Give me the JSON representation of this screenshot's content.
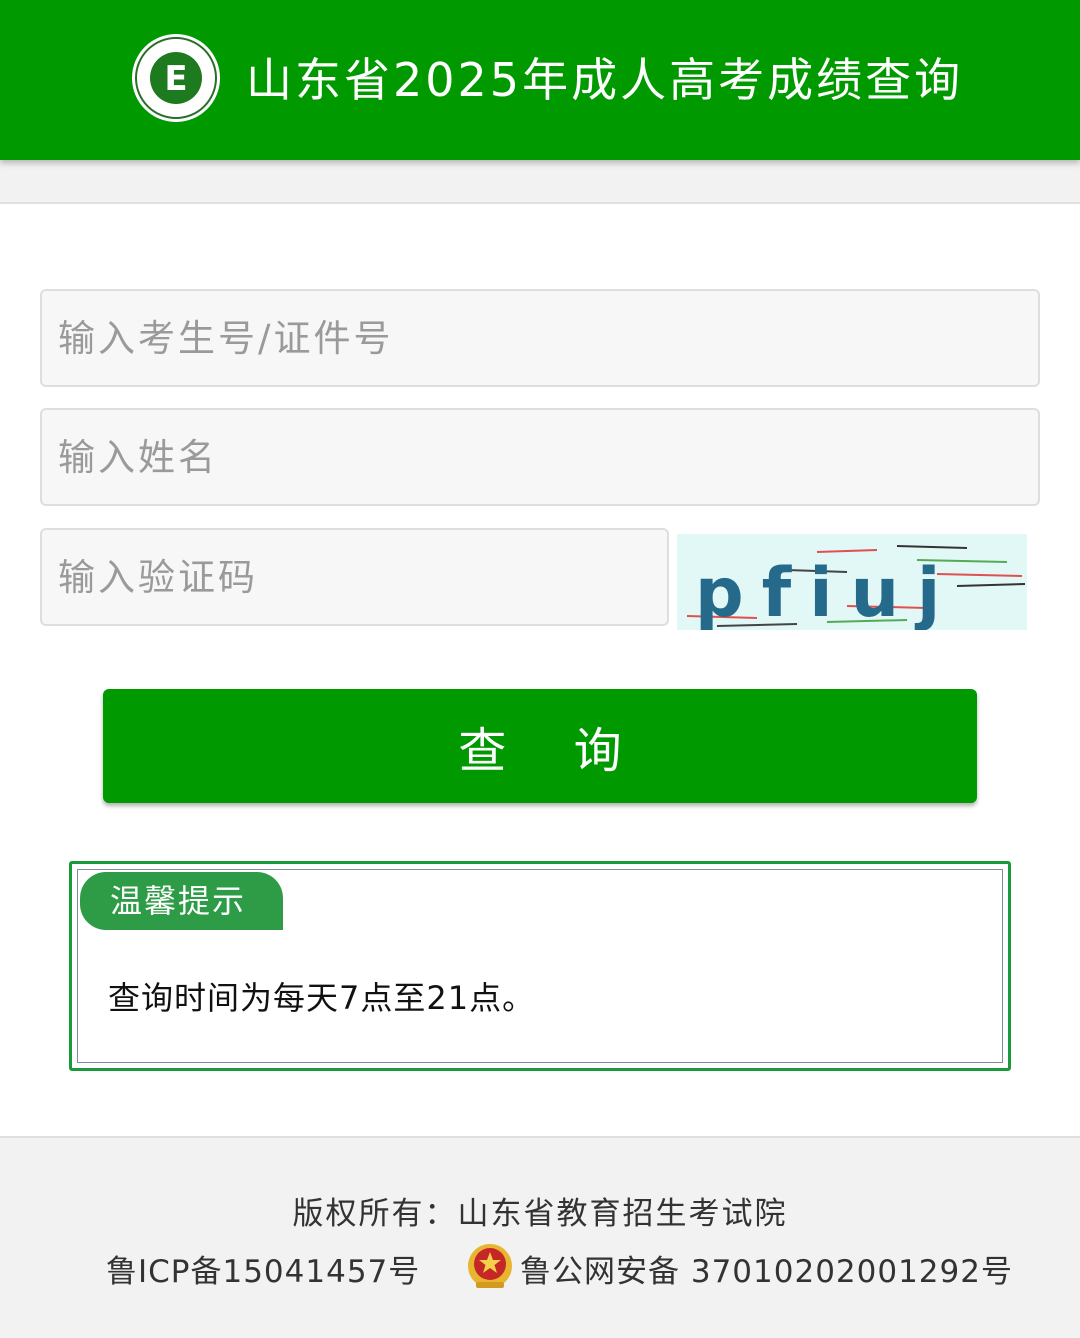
{
  "header": {
    "title": "山东省2025年成人高考成绩查询",
    "logo_icon": "exam-authority-logo-icon",
    "color": "#009a00"
  },
  "form": {
    "id_placeholder": "输入考生号/证件号",
    "name_placeholder": "输入姓名",
    "captcha_placeholder": "输入验证码",
    "captcha_text": "pfiuj",
    "submit_label": "查 询"
  },
  "notice": {
    "tag": "温馨提示",
    "text": "查询时间为每天7点至21点。"
  },
  "footer": {
    "copyright": "版权所有：山东省教育招生考试院",
    "icp": "鲁ICP备15041457号",
    "police_icon": "police-badge-icon",
    "police": "鲁公网安备 37010202001292号"
  }
}
